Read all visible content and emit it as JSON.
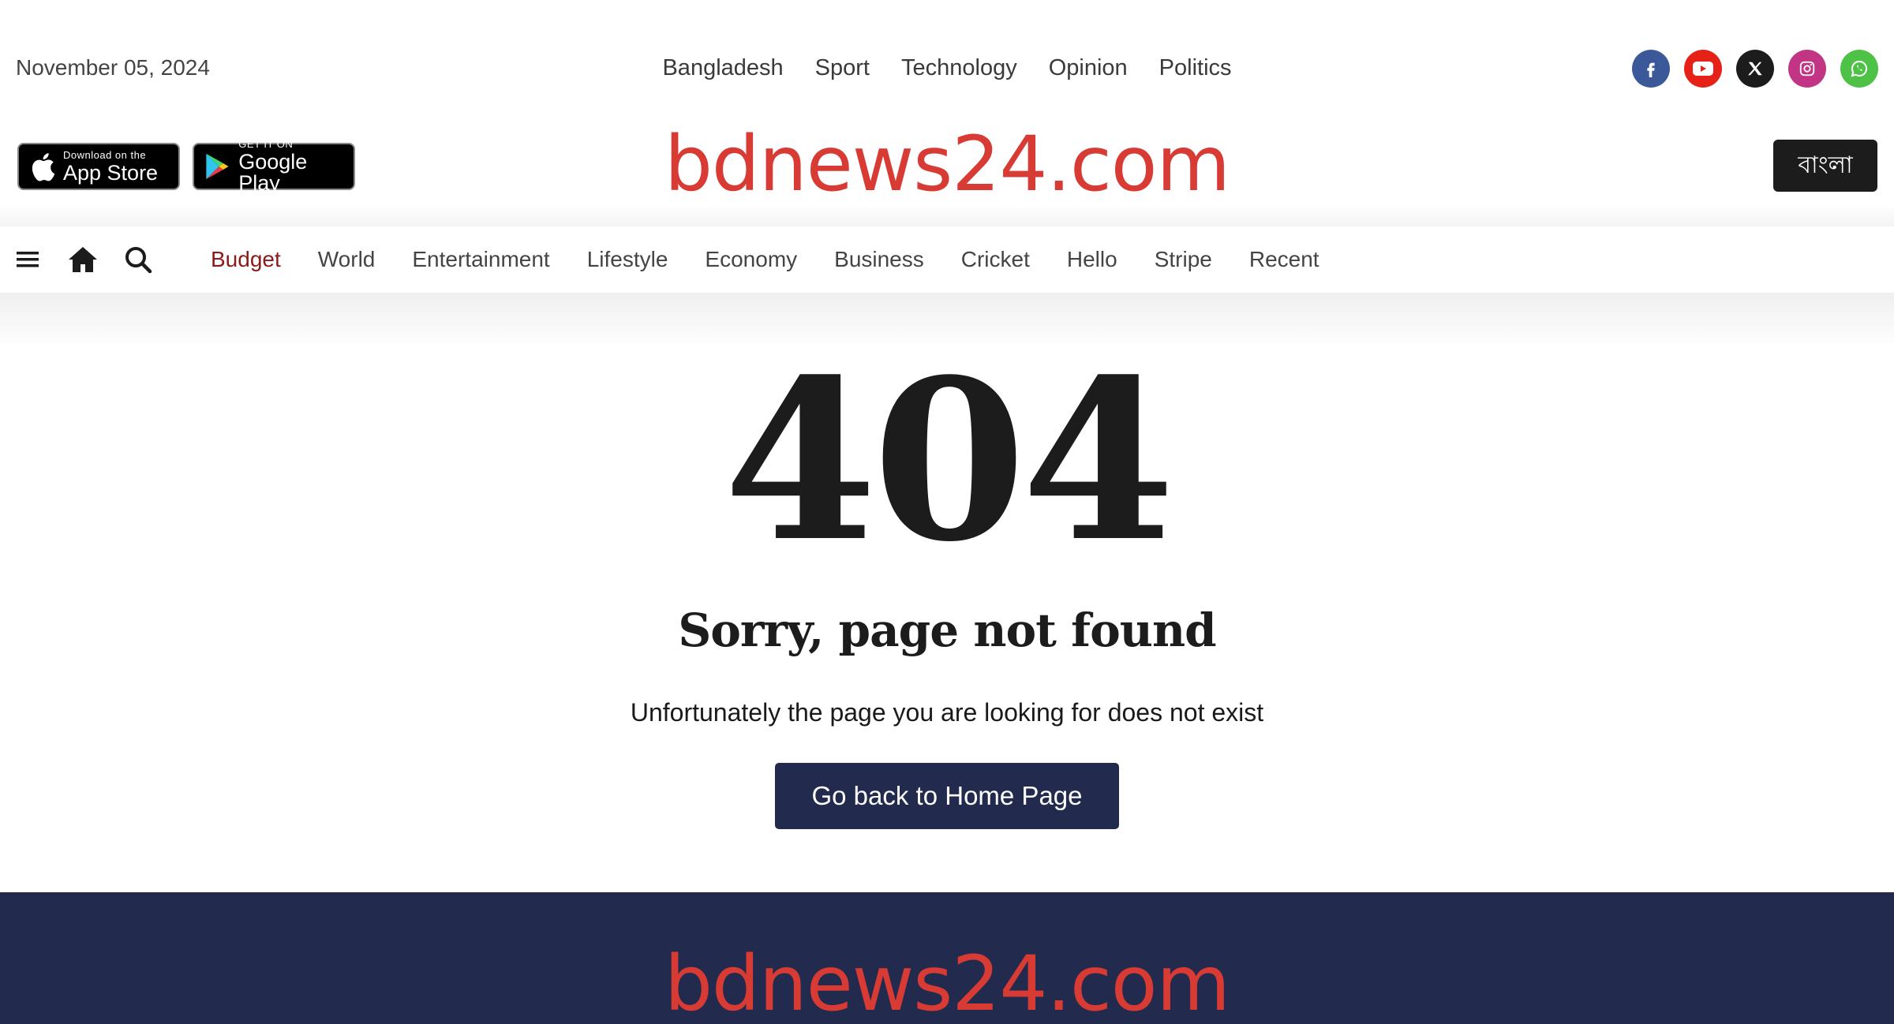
{
  "header": {
    "date": "November 05, 2024",
    "top_nav": [
      "Bangladesh",
      "Sport",
      "Technology",
      "Opinion",
      "Politics"
    ],
    "social": [
      {
        "name": "facebook",
        "icon": "facebook-icon",
        "color": "#3b5998"
      },
      {
        "name": "youtube",
        "icon": "youtube-icon",
        "color": "#e62117"
      },
      {
        "name": "x",
        "icon": "x-icon",
        "color": "#1c1c1c"
      },
      {
        "name": "instagram",
        "icon": "instagram-icon",
        "color": "#c13584"
      },
      {
        "name": "whatsapp",
        "icon": "whatsapp-icon",
        "color": "#4dc247"
      }
    ]
  },
  "badges": {
    "appstore_small": "Download on the",
    "appstore_big": "App Store",
    "gplay_small": "GET IT ON",
    "gplay_big": "Google Play"
  },
  "brand": {
    "logo": "bdnews24.com",
    "lang_button": "বাংলা",
    "logo_color": "#d83a34"
  },
  "category_nav": {
    "items": [
      "Budget",
      "World",
      "Entertainment",
      "Lifestyle",
      "Economy",
      "Business",
      "Cricket",
      "Hello",
      "Stripe",
      "Recent"
    ],
    "active": "Budget",
    "active_color": "#8b1a1a"
  },
  "error": {
    "code": "404",
    "title": "Sorry, page not found",
    "message": "Unfortunately the page you are looking for does not exist",
    "button": "Go back to Home Page",
    "button_color": "#222b4e"
  },
  "footer": {
    "logo": "bdnews24.com",
    "background": "#222b4e"
  }
}
